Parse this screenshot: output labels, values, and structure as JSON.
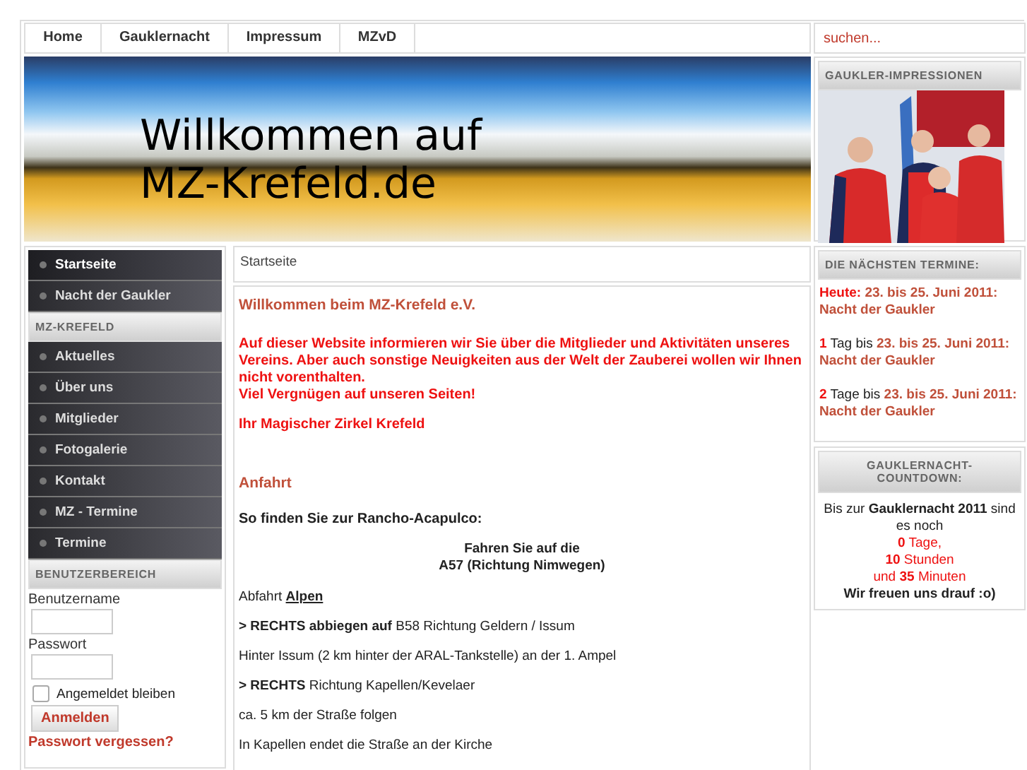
{
  "top_nav": [
    {
      "label": "Home"
    },
    {
      "label": "Gauklernacht"
    },
    {
      "label": "Impressum"
    },
    {
      "label": "MZvD"
    }
  ],
  "search": {
    "placeholder": "suchen..."
  },
  "banner": {
    "line_1": "Willkommen auf",
    "line_2": "MZ-Krefeld.de"
  },
  "sidebar": {
    "items": [
      {
        "label": "Startseite",
        "selected": true
      },
      {
        "label": "Nacht der Gaukler",
        "selected": false
      }
    ],
    "section_title": "MZ-KREFELD",
    "section_items": [
      {
        "label": "Aktuelles",
        "selected": false
      },
      {
        "label": "Über uns",
        "selected": false
      },
      {
        "label": "Mitglieder",
        "selected": false
      },
      {
        "label": "Fotogalerie",
        "selected": false
      },
      {
        "label": "Kontakt",
        "selected": false
      },
      {
        "label": "MZ - Termine",
        "selected": false
      },
      {
        "label": "Termine",
        "selected": false
      }
    ]
  },
  "login": {
    "title": "BENUTZERBEREICH",
    "username_label": "Benutzername",
    "password_label": "Passwort",
    "remember": {
      "label": "Angemeldet bleiben",
      "checked": false
    },
    "submit": "Anmelden",
    "forgot": "Passwort vergessen?"
  },
  "breadcrumb": "Startseite",
  "article": {
    "title": "Willkommen beim MZ-Krefeld e.V.",
    "intro": [
      "Auf dieser Website informieren wir Sie über die Mitglieder und Aktivitäten unseres Vereins. Aber auch sonstige Neuigkeiten aus der Welt der Zauberei wollen wir Ihnen nicht vorenthalten.",
      "Viel Vergnügen auf unseren Seiten!"
    ],
    "signature": "Ihr Magischer Zirkel Krefeld",
    "subtitle": "Anfahrt",
    "directions": [
      {
        "kind": "heading",
        "text": "So finden Sie zur Rancho-Acapulco:"
      },
      {
        "kind": "center",
        "lines": [
          "Fahren Sie auf die",
          "A57 (Richtung Nimwegen)"
        ]
      },
      {
        "kind": "link",
        "text": "Abfahrt",
        "link": "Alpen"
      },
      {
        "kind": "plain",
        "text": "**> RECHTS abbiegen auf** B58 Richtung Geldern / Issum"
      },
      {
        "kind": "plain",
        "text": "Hinter Issum (2 km hinter der ARAL-Tankstelle) an der 1. Ampel"
      },
      {
        "kind": "plain",
        "text": "**> RECHTS** Richtung Kapellen/Kevelaer"
      },
      {
        "kind": "plain",
        "text": "ca. 5 km der Straße folgen"
      },
      {
        "kind": "plain",
        "text": "In Kapellen endet die Straße an der Kirche"
      }
    ]
  },
  "impressions": {
    "title": "GAUKLER-IMPRESSIONEN"
  },
  "events": {
    "title": "DIE NÄCHSTEN TERMINE:",
    "items": [
      {
        "kind": "today",
        "lead": "Heute:",
        "link": "23. bis 25. Juni 2011: Nacht der Gaukler"
      },
      {
        "kind": "countdown",
        "count": "1",
        "unit": "Tag bis",
        "link": "23. bis 25. Juni 2011: Nacht der Gaukler"
      },
      {
        "kind": "countdown",
        "count": "2",
        "unit": "Tage bis",
        "link": "23. bis 25. Juni 2011: Nacht der Gaukler"
      }
    ]
  },
  "countdown": {
    "title": "GAUKLERNACHT-COUNTDOWN:",
    "intro": "Bis zur **Gauklernacht 2011** sind es noch",
    "lines": [
      "**0** Tage,",
      "**10** Stunden",
      "und **35** Minuten"
    ],
    "closing": "Wir freuen uns drauf :o)"
  }
}
